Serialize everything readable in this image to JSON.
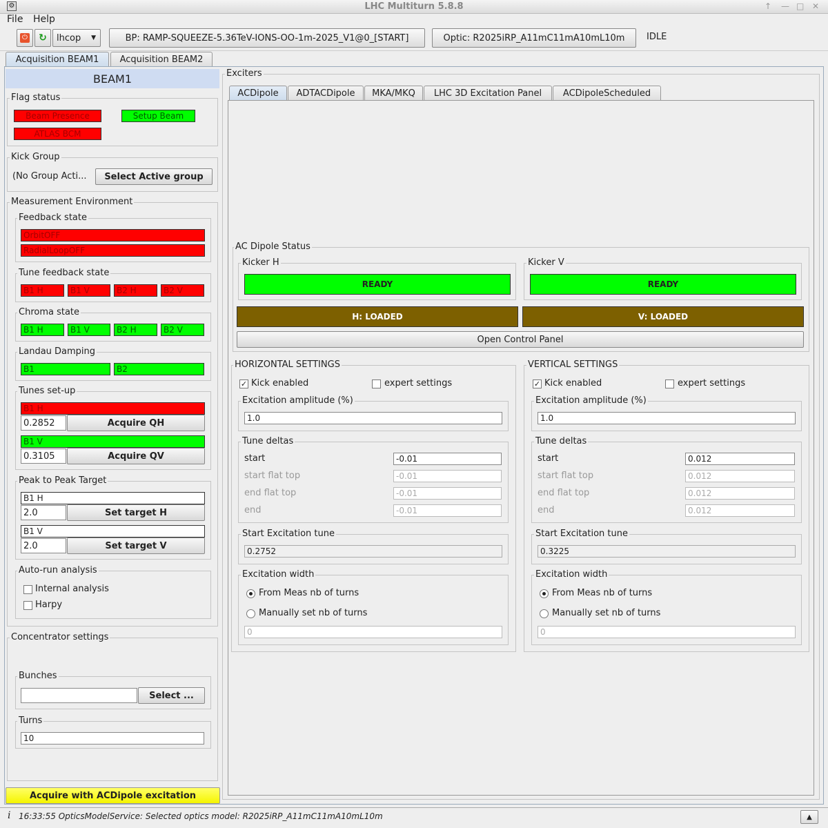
{
  "window": {
    "title": "LHC Multiturn 5.8.8"
  },
  "menu": {
    "file": "File",
    "help": "Help"
  },
  "toolbar": {
    "user": "lhcop",
    "beam_process": "BP: RAMP-SQUEEZE-5.36TeV-IONS-OO-1m-2025_V1@0_[START]",
    "optic": "Optic: R2025iRP_A11mC11mA10mL10m",
    "state": "IDLE"
  },
  "main_tabs": [
    "Acquisition BEAM1",
    "Acquisition BEAM2"
  ],
  "left": {
    "beam_title": "BEAM1",
    "flag_status": {
      "label": "Flag status",
      "beam_presence": "Beam Presence",
      "setup_beam": "Setup Beam",
      "atlas_bcm": "ATLAS BCM"
    },
    "kick_group": {
      "label": "Kick Group",
      "value": "(No Group Acti...",
      "button": "Select Active group"
    },
    "meas_env": {
      "label": "Measurement Environment",
      "feedback_state": {
        "label": "Feedback state",
        "orbit": "OrbitOFF",
        "radial": "RadialLoopOFF"
      },
      "tune_feedback": {
        "label": "Tune feedback state",
        "items": [
          "B1 H",
          "B1 V",
          "B2 H",
          "B2 V"
        ]
      },
      "chroma": {
        "label": "Chroma state",
        "items": [
          "B1 H",
          "B1 V",
          "B2 H",
          "B2 V"
        ]
      },
      "landau": {
        "label": "Landau Damping",
        "items": [
          "B1",
          "B2"
        ]
      },
      "tunes_setup": {
        "label": "Tunes set-up",
        "h_label": "B1 H",
        "h_value": "0.2852",
        "h_button": "Acquire QH",
        "v_label": "B1 V",
        "v_value": "0.3105",
        "v_button": "Acquire QV"
      },
      "p2p": {
        "label": "Peak to Peak Target",
        "h_label": "B1 H",
        "h_value": "2.0",
        "h_button": "Set target H",
        "v_label": "B1 V",
        "v_value": "2.0",
        "v_button": "Set target V"
      },
      "autorun": {
        "label": "Auto-run analysis",
        "internal": "Internal analysis",
        "harpy": "Harpy"
      }
    },
    "concentrator": {
      "label": "Concentrator settings",
      "bunches_label": "Bunches",
      "bunches_value": "",
      "select_button": "Select ...",
      "turns_label": "Turns",
      "turns_value": "10"
    },
    "acquire_button": "Acquire with ACDipole excitation"
  },
  "exciters": {
    "label": "Exciters",
    "tabs": [
      "ACDipole",
      "ADTACDipole",
      "MKA/MKQ",
      "LHC 3D Excitation Panel",
      "ACDipoleScheduled"
    ],
    "status": {
      "label": "AC Dipole Status",
      "kicker_h_label": "Kicker H",
      "kicker_h": "READY",
      "kicker_v_label": "Kicker V",
      "kicker_v": "READY",
      "h_loaded": "H: LOADED",
      "v_loaded": "V: LOADED",
      "open_panel": "Open Control Panel"
    },
    "horizontal": {
      "label": "HORIZONTAL SETTINGS",
      "kick_enabled": "Kick enabled",
      "expert": "expert settings",
      "amp_label": "Excitation amplitude (%)",
      "amp": "1.0",
      "deltas_label": "Tune deltas",
      "start_label": "start",
      "start": "-0.01",
      "sft_label": "start flat top",
      "sft": "-0.01",
      "eft_label": "end flat top",
      "eft": "-0.01",
      "end_label": "end",
      "end": "-0.01",
      "set_label": "Start Excitation tune",
      "set": "0.2752",
      "width_label": "Excitation width",
      "from_meas": "From Meas nb of turns",
      "manual": "Manually set nb of turns",
      "turns": "0"
    },
    "vertical": {
      "label": "VERTICAL SETTINGS",
      "kick_enabled": "Kick enabled",
      "expert": "expert settings",
      "amp_label": "Excitation amplitude (%)",
      "amp": "1.0",
      "deltas_label": "Tune deltas",
      "start_label": "start",
      "start": "0.012",
      "sft_label": "start flat top",
      "sft": "0.012",
      "eft_label": "end flat top",
      "eft": "0.012",
      "end_label": "end",
      "end": "0.012",
      "set_label": "Start Excitation tune",
      "set": "0.3225",
      "width_label": "Excitation width",
      "from_meas": "From Meas nb of turns",
      "manual": "Manually set nb of turns",
      "turns": "0"
    }
  },
  "status_bar": {
    "message": "16:33:55 OpticsModelService: Selected optics model: R2025iRP_A11mC11mA10mL10m"
  }
}
